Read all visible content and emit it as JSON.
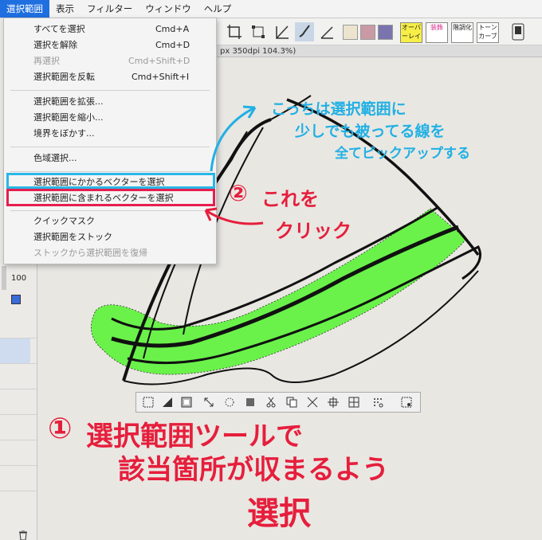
{
  "menubar": {
    "items": [
      {
        "label": "選択範囲",
        "active": true
      },
      {
        "label": "表示"
      },
      {
        "label": "フィルター"
      },
      {
        "label": "ウィンドウ"
      },
      {
        "label": "ヘルプ"
      }
    ]
  },
  "toolbar": {
    "colors": [
      "#ece4cf",
      "#c99aa4",
      "#7a74ae"
    ],
    "buttons": [
      "オーバーレイ",
      "装飾",
      "階調化",
      "トーンカーブ"
    ]
  },
  "document_tab": {
    "title": "px 350dpi 104.3%)"
  },
  "left_panel": {
    "opacity": "100"
  },
  "select_menu": {
    "items": [
      {
        "label": "すべてを選択",
        "shortcut": "Cmd+A"
      },
      {
        "label": "選択を解除",
        "shortcut": "Cmd+D"
      },
      {
        "label": "再選択",
        "shortcut": "Cmd+Shift+D",
        "disabled": true
      },
      {
        "label": "選択範囲を反転",
        "shortcut": "Cmd+Shift+I"
      },
      {
        "label": "選択範囲を拡張..."
      },
      {
        "label": "選択範囲を縮小..."
      },
      {
        "label": "境界をぼかす..."
      },
      {
        "label": "色域選択..."
      },
      {
        "label": "選択範囲にかかるベクターを選択"
      },
      {
        "label": "選択範囲に含まれるベクターを選択"
      },
      {
        "label": "クイックマスク"
      },
      {
        "label": "選択範囲をストック"
      },
      {
        "label": "ストックから選択範囲を復帰",
        "disabled": true
      }
    ]
  },
  "annotations": {
    "cyan_line1": "こっちは選択範囲に",
    "cyan_line2": "少しでも被ってる線を",
    "cyan_line3": "全てピックアップする",
    "step2_number": "②",
    "step2_line1": "これを",
    "step2_line2": "クリック",
    "step1_number": "①",
    "step1_line1": "選択範囲ツールで",
    "step1_line2": "該当箇所が収まるよう",
    "step1_line3": "選択"
  },
  "colors": {
    "accent_cyan": "#22b0e4",
    "accent_red": "#e61e3c",
    "selection_green": "#6af24a",
    "menu_highlight": "#1f6fe0"
  }
}
